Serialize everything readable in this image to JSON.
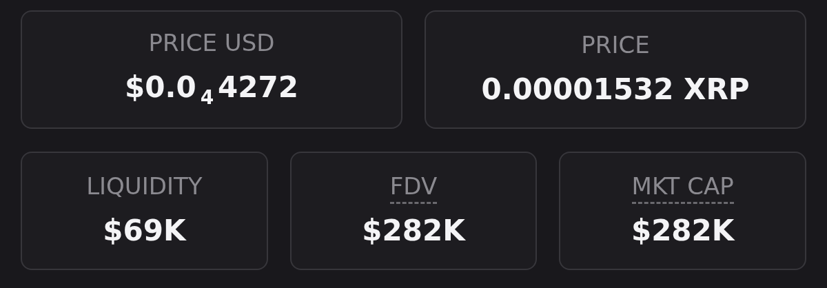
{
  "top_stats": [
    {
      "label": "PRICE USD",
      "value": "$0.0$_{4}$4272",
      "has_tooltip": false
    },
    {
      "label": "PRICE",
      "value": "0.00001532 XRP",
      "has_tooltip": false
    }
  ],
  "bottom_stats": [
    {
      "label": "LIQUIDITY",
      "value": "$69K",
      "has_tooltip": false
    },
    {
      "label": "FDV",
      "value": "$282K",
      "has_tooltip": true
    },
    {
      "label": "MKT CAP",
      "value": "$282K",
      "has_tooltip": true
    }
  ]
}
